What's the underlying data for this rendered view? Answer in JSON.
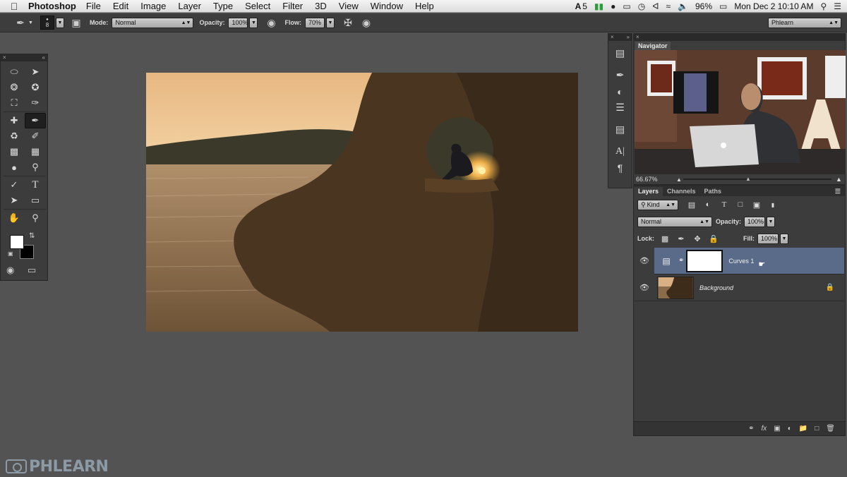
{
  "menubar": {
    "app": "Photoshop",
    "items": [
      "File",
      "Edit",
      "Image",
      "Layer",
      "Type",
      "Select",
      "Filter",
      "3D",
      "View",
      "Window",
      "Help"
    ],
    "status": {
      "adobe": "5",
      "battery": "96%",
      "datetime": "Mon Dec 2  10:10 AM"
    }
  },
  "options": {
    "brush_size": "8",
    "mode_label": "Mode:",
    "mode_value": "Normal",
    "opacity_label": "Opacity:",
    "opacity_value": "100%",
    "flow_label": "Flow:",
    "flow_value": "70%",
    "workspace": "Phlearn"
  },
  "navigator": {
    "tab": "Navigator",
    "zoom": "66.67%"
  },
  "layers_panel": {
    "tabs": [
      "Layers",
      "Channels",
      "Paths"
    ],
    "filter": "Kind",
    "blend_mode": "Normal",
    "opacity_label": "Opacity:",
    "opacity_value": "100%",
    "lock_label": "Lock:",
    "fill_label": "Fill:",
    "fill_value": "100%",
    "layers": [
      {
        "name": "Curves 1",
        "selected": true
      },
      {
        "name": "Background",
        "selected": false
      }
    ]
  },
  "watermark": "PHLEARN",
  "colors": {
    "selection": "#5a6b8a",
    "panel": "#3c3c3c",
    "workspace": "#535353"
  }
}
